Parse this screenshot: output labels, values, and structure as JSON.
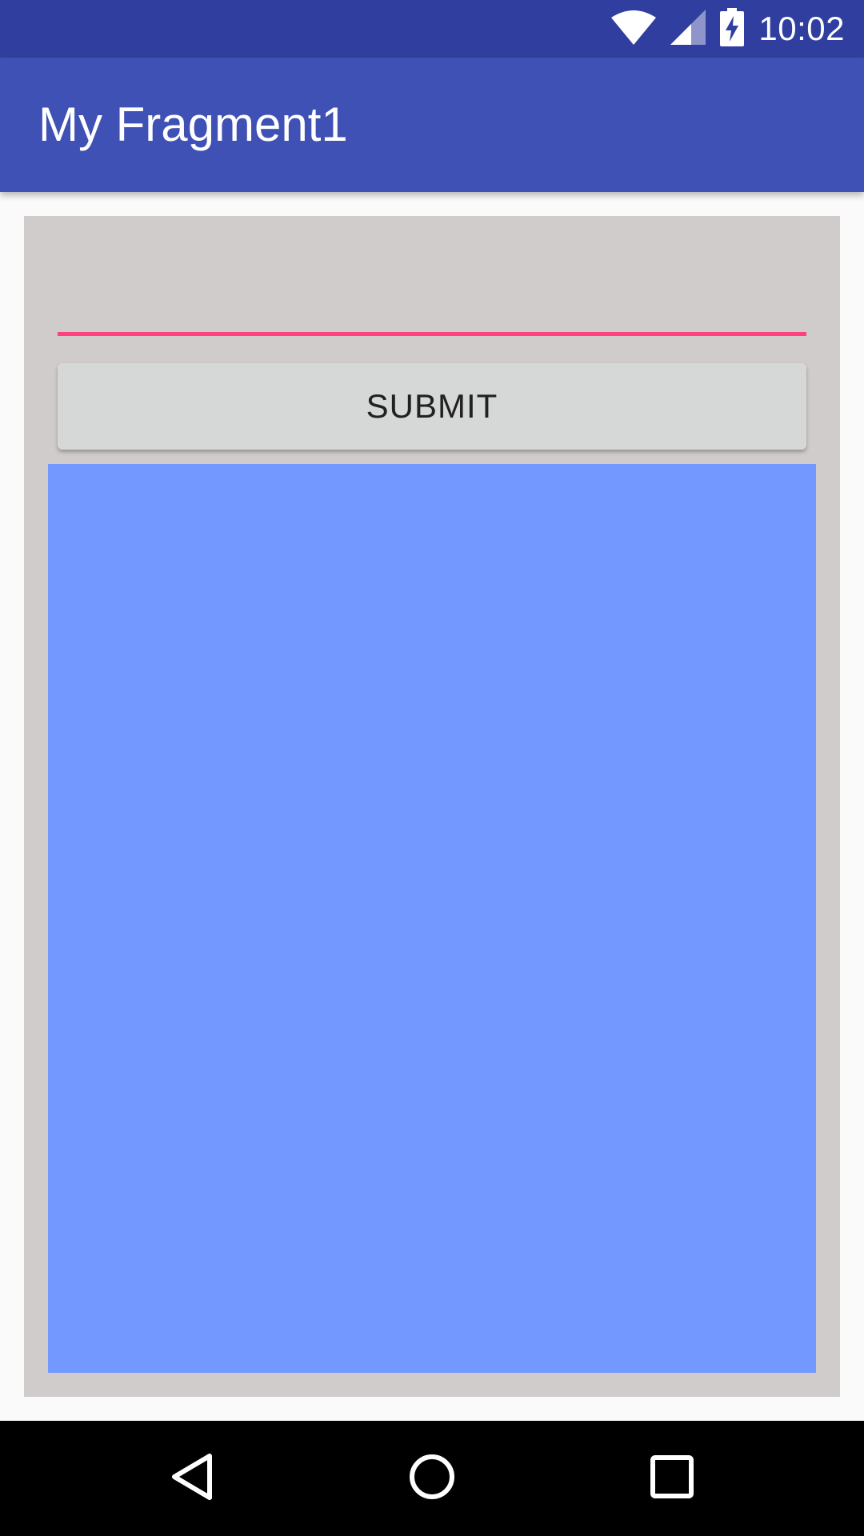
{
  "status_bar": {
    "time": "10:02",
    "icons": [
      "wifi-icon",
      "cell-signal-icon",
      "battery-charging-icon"
    ],
    "color": "#303f9f"
  },
  "app_bar": {
    "title": "My Fragment1",
    "color": "#3f51b5"
  },
  "form": {
    "input_value": "",
    "input_underline_color": "#ff4081",
    "submit_label": "SUBMIT"
  },
  "panel": {
    "color": "#7398ff"
  },
  "nav_bar": {
    "icons": [
      "back-icon",
      "home-icon",
      "recents-icon"
    ]
  }
}
